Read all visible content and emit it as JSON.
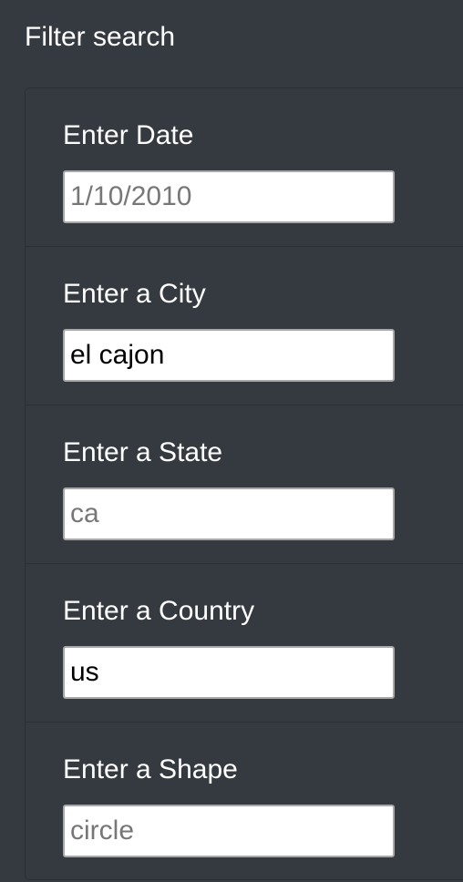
{
  "panel": {
    "title": "Filter search"
  },
  "filters": [
    {
      "label": "Enter Date",
      "value": "",
      "placeholder": "1/10/2010"
    },
    {
      "label": "Enter a City",
      "value": "el cajon",
      "placeholder": ""
    },
    {
      "label": "Enter a State",
      "value": "",
      "placeholder": "ca"
    },
    {
      "label": "Enter a Country",
      "value": "us",
      "placeholder": ""
    },
    {
      "label": "Enter a Shape",
      "value": "",
      "placeholder": "circle"
    }
  ],
  "colors": {
    "panel_background": "#343a40",
    "text": "#ffffff",
    "input_background": "#ffffff",
    "placeholder": "#777777"
  }
}
